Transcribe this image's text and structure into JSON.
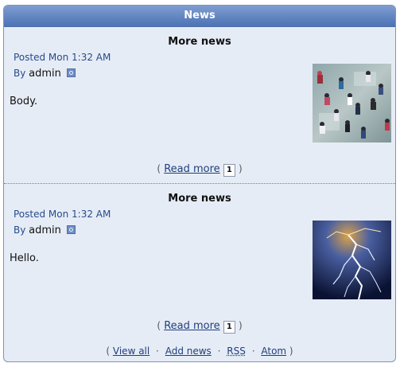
{
  "panel": {
    "title": "News"
  },
  "items": [
    {
      "title": "More news",
      "posted": "Posted Mon 1:32 AM",
      "by_label": "By",
      "author": "admin",
      "body": "Body.",
      "read_more": "Read more",
      "comment_count": "1",
      "image": "crowd-photo"
    },
    {
      "title": "More news",
      "posted": "Posted Mon 1:32 AM",
      "by_label": "By",
      "author": "admin",
      "body": "Hello.",
      "read_more": "Read more",
      "comment_count": "1",
      "image": "lightning-photo"
    }
  ],
  "footer": {
    "view_all": "View all",
    "add_news": "Add news",
    "rss": "RSS",
    "atom": "Atom",
    "open_paren": "(",
    "close_paren": ")",
    "separator": "·"
  },
  "colors": {
    "header_top": "#7e9dd1",
    "header_bottom": "#4d73b4",
    "panel_bg": "#e6ecf6",
    "link": "#1f3f7d"
  }
}
